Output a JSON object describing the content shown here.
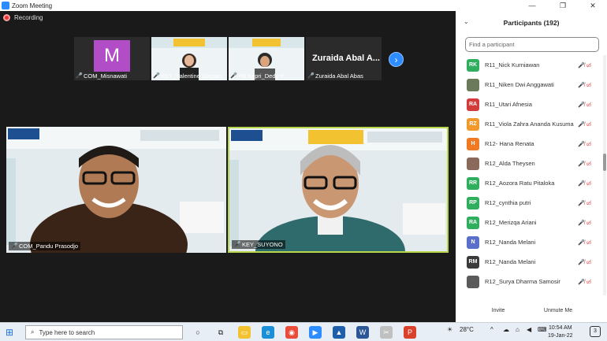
{
  "window": {
    "title": "Zoom Meeting",
    "controls": [
      "—",
      "❐",
      "✕"
    ]
  },
  "recording": {
    "label": "Recording"
  },
  "gallery": [
    {
      "name": "COM_Misnawati",
      "avatar_letter": "M",
      "avatar_color": "#b14ec7"
    },
    {
      "name": "KEY_Valentine Siagian"
    },
    {
      "name": "PB Kepri_Dedy P"
    },
    {
      "name": "Zuraida Abal Abas",
      "large_label": "Zuraida Abal A..."
    }
  ],
  "main_videos": [
    {
      "name": "COM_Pandu Prasodjo"
    },
    {
      "name": "KEY_SUYONO",
      "active_speaker": true
    }
  ],
  "participants": {
    "title": "Participants (192)",
    "search_placeholder": "Find a participant",
    "items": [
      {
        "initials": "RK",
        "color": "#2fae5d",
        "name": "R11_Nick Kurniawan"
      },
      {
        "initials": "",
        "color": "#6a7a5a",
        "name": "R11_Niken Dwi Anggawati",
        "photo": true
      },
      {
        "initials": "RA",
        "color": "#d33b3b",
        "name": "R11_Utari Afnesia"
      },
      {
        "initials": "RZ",
        "color": "#f09a2e",
        "name": "R11_Viola Zahra Ananda Kusuma"
      },
      {
        "initials": "H",
        "color": "#f07a23",
        "name": "R12- Hana Renata"
      },
      {
        "initials": "",
        "color": "#8a6a5a",
        "name": "R12_Alda Theysen",
        "photo": true
      },
      {
        "initials": "RR",
        "color": "#2fae5d",
        "name": "R12_Aozora Ratu Pitaloka"
      },
      {
        "initials": "RP",
        "color": "#2fae5d",
        "name": "R12_cynthia putri"
      },
      {
        "initials": "RA",
        "color": "#2fae5d",
        "name": "R12_Merizqa Ariani"
      },
      {
        "initials": "N",
        "color": "#5a6fc9",
        "name": "R12_Nanda Melani"
      },
      {
        "initials": "RM",
        "color": "#3a3a3a",
        "name": "R12_Nanda Melani"
      },
      {
        "initials": "",
        "color": "#5a5a5a",
        "name": "R12_Surya Dharma Samosir",
        "photo": true
      }
    ],
    "invite_label": "Invite",
    "unmute_label": "Unmute Me"
  },
  "taskbar": {
    "search_placeholder": "Type here to search",
    "weather": "28°C",
    "time": "10:54 AM",
    "date": "19-Jan-22",
    "notification_count": "3"
  }
}
